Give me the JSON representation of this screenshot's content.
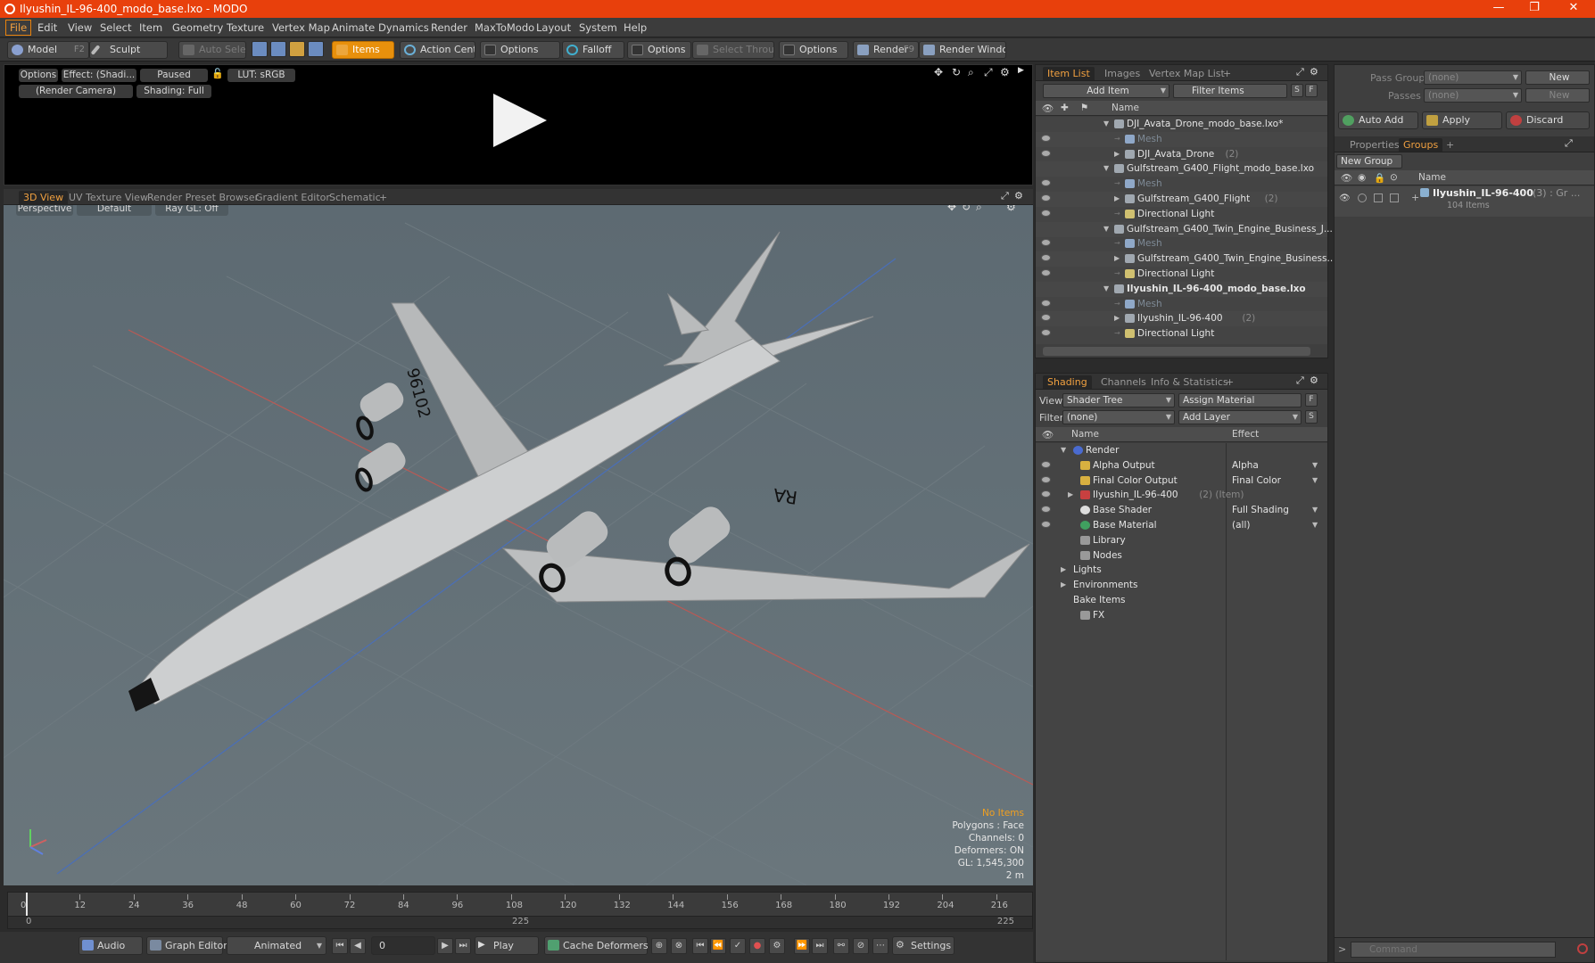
{
  "window": {
    "title": "Ilyushin_IL-96-400_modo_base.lxo - MODO",
    "controls": [
      "—",
      "❐",
      "✕"
    ]
  },
  "menu": [
    "File",
    "Edit",
    "View",
    "Select",
    "Item",
    "Geometry",
    "Texture",
    "Vertex Map",
    "Animate",
    "Dynamics",
    "Render",
    "MaxToModo",
    "Layout",
    "System",
    "Help"
  ],
  "toolbar": {
    "model": "Model",
    "model_key": "F2",
    "sculpt": "Sculpt",
    "auto_select": "Auto Select",
    "items": "Items",
    "action_center": "Action Center",
    "options1": "Options",
    "falloff": "Falloff",
    "options2": "Options",
    "select_through": "Select Through",
    "options3": "Options",
    "render": "Render",
    "render_key": "F9",
    "render_window": "Render Window"
  },
  "render_preview": {
    "options": "Options",
    "effect": "Effect: (Shadi...",
    "paused": "Paused",
    "lut": "LUT: sRGB",
    "camera": "(Render Camera)",
    "shading": "Shading: Full"
  },
  "viewport_tabs": [
    "3D View",
    "UV Texture View",
    "Render Preset Browser",
    "Gradient Editor",
    "Schematic",
    "+"
  ],
  "viewport": {
    "perspective": "Perspective",
    "default": "Default",
    "raygl": "Ray GL: Off",
    "stats": {
      "no_items": "No Items",
      "polygons": "Polygons : Face",
      "channels": "Channels: 0",
      "deformers": "Deformers: ON",
      "gl": "GL: 1,545,300",
      "scale": "2 m"
    }
  },
  "timeline": {
    "ticks": [
      "0",
      "12",
      "24",
      "36",
      "48",
      "60",
      "72",
      "84",
      "96",
      "108",
      "120",
      "132",
      "144",
      "156",
      "168",
      "180",
      "192",
      "204",
      "216"
    ],
    "range_start": "0",
    "range_mid": "225",
    "range_end": "225"
  },
  "bottombar": {
    "audio": "Audio",
    "graph_editor": "Graph Editor",
    "animated": "Animated",
    "frame": "0",
    "play": "Play",
    "cache_deformers": "Cache Deformers",
    "settings": "Settings"
  },
  "item_list": {
    "tabs": [
      "Item List",
      "Images",
      "Vertex Map List",
      "+"
    ],
    "add_item": "Add Item",
    "filter_items": "Filter Items",
    "s": "S",
    "f": "F",
    "col_name": "Name",
    "rows": [
      {
        "label": "DJI_Avata_Drone_modo_base.lxo*",
        "indent": 0,
        "tri": "▼",
        "kind": "scene",
        "dim": false,
        "bold": false,
        "count": ""
      },
      {
        "label": "Mesh",
        "indent": 1,
        "tri": "",
        "kind": "mesh",
        "dim": true,
        "bold": false,
        "count": ""
      },
      {
        "label": "DJI_Avata_Drone",
        "indent": 1,
        "tri": "▶",
        "kind": "group",
        "dim": false,
        "bold": false,
        "count": "(2)"
      },
      {
        "label": "Gulfstream_G400_Flight_modo_base.lxo",
        "indent": 0,
        "tri": "▼",
        "kind": "scene",
        "dim": false,
        "bold": false,
        "count": ""
      },
      {
        "label": "Mesh",
        "indent": 1,
        "tri": "",
        "kind": "mesh",
        "dim": true,
        "bold": false,
        "count": ""
      },
      {
        "label": "Gulfstream_G400_Flight",
        "indent": 1,
        "tri": "▶",
        "kind": "group",
        "dim": false,
        "bold": false,
        "count": "(2)"
      },
      {
        "label": "Directional Light",
        "indent": 1,
        "tri": "",
        "kind": "light",
        "dim": false,
        "bold": false,
        "count": ""
      },
      {
        "label": "Gulfstream_G400_Twin_Engine_Business_J...",
        "indent": 0,
        "tri": "▼",
        "kind": "scene",
        "dim": false,
        "bold": false,
        "count": ""
      },
      {
        "label": "Mesh",
        "indent": 1,
        "tri": "",
        "kind": "mesh",
        "dim": true,
        "bold": false,
        "count": ""
      },
      {
        "label": "Gulfstream_G400_Twin_Engine_Business...",
        "indent": 1,
        "tri": "▶",
        "kind": "group",
        "dim": false,
        "bold": false,
        "count": ""
      },
      {
        "label": "Directional Light",
        "indent": 1,
        "tri": "",
        "kind": "light",
        "dim": false,
        "bold": false,
        "count": ""
      },
      {
        "label": "Ilyushin_IL-96-400_modo_base.lxo",
        "indent": 0,
        "tri": "▼",
        "kind": "scene",
        "dim": false,
        "bold": true,
        "count": ""
      },
      {
        "label": "Mesh",
        "indent": 1,
        "tri": "",
        "kind": "mesh",
        "dim": true,
        "bold": false,
        "count": ""
      },
      {
        "label": "Ilyushin_IL-96-400",
        "indent": 1,
        "tri": "▶",
        "kind": "group",
        "dim": false,
        "bold": false,
        "count": "(2)"
      },
      {
        "label": "Directional Light",
        "indent": 1,
        "tri": "",
        "kind": "light",
        "dim": false,
        "bold": false,
        "count": ""
      }
    ]
  },
  "shading": {
    "tabs": [
      "Shading",
      "Channels",
      "Info & Statistics",
      "+"
    ],
    "view_label": "View",
    "view_value": "Shader Tree",
    "assign_material": "Assign Material",
    "f": "F",
    "filter_label": "Filter",
    "filter_value": "(none)",
    "add_layer": "Add Layer",
    "s": "S",
    "col_name": "Name",
    "col_effect": "Effect",
    "rows": [
      {
        "label": "Render",
        "indent": 0,
        "tri": "▼",
        "effect": "",
        "eye": false,
        "icon": "#4a6bd0",
        "suffix": ""
      },
      {
        "label": "Alpha Output",
        "indent": 1,
        "tri": "",
        "effect": "Alpha",
        "eye": true,
        "icon": "#d8b040",
        "suffix": ""
      },
      {
        "label": "Final Color Output",
        "indent": 1,
        "tri": "",
        "effect": "Final Color",
        "eye": true,
        "icon": "#d8b040",
        "suffix": ""
      },
      {
        "label": "Ilyushin_IL-96-400",
        "indent": 1,
        "tri": "▶",
        "effect": "",
        "eye": true,
        "icon": "#c84040",
        "suffix": "(2) (Item)"
      },
      {
        "label": "Base Shader",
        "indent": 1,
        "tri": "",
        "effect": "Full Shading",
        "eye": true,
        "icon": "#dddddd",
        "suffix": ""
      },
      {
        "label": "Base Material",
        "indent": 1,
        "tri": "",
        "effect": "(all)",
        "eye": true,
        "icon": "#40a060",
        "suffix": ""
      },
      {
        "label": "Library",
        "indent": 1,
        "tri": "",
        "effect": "",
        "eye": false,
        "icon": "#999999",
        "suffix": ""
      },
      {
        "label": "Nodes",
        "indent": 1,
        "tri": "",
        "effect": "",
        "eye": false,
        "icon": "#999999",
        "suffix": ""
      },
      {
        "label": "Lights",
        "indent": 0,
        "tri": "▶",
        "effect": "",
        "eye": false,
        "icon": "",
        "suffix": ""
      },
      {
        "label": "Environments",
        "indent": 0,
        "tri": "▶",
        "effect": "",
        "eye": false,
        "icon": "",
        "suffix": ""
      },
      {
        "label": "Bake Items",
        "indent": 0,
        "tri": "",
        "effect": "",
        "eye": false,
        "icon": "",
        "suffix": ""
      },
      {
        "label": "FX",
        "indent": 1,
        "tri": "",
        "effect": "",
        "eye": false,
        "icon": "#999999",
        "suffix": ""
      }
    ]
  },
  "right_panel": {
    "pass_groups_label": "Pass Groups",
    "pass_groups_value": "(none)",
    "new1": "New",
    "passes_label": "Passes",
    "passes_value": "(none)",
    "new2": "New",
    "auto_add": "Auto Add",
    "apply": "Apply",
    "discard": "Discard",
    "tabs": [
      "Properties",
      "Groups",
      "+"
    ],
    "new_group": "New Group",
    "col_name": "Name",
    "group_name": "Ilyushin_IL-96-400",
    "group_suffix": "(3) : Gr ...",
    "group_items": "104 Items",
    "command_placeholder": "Command"
  },
  "colors": {
    "accent": "#e8900c",
    "title_bar": "#e8400c",
    "panel": "#3f3f3f",
    "viewport": "#637076"
  }
}
